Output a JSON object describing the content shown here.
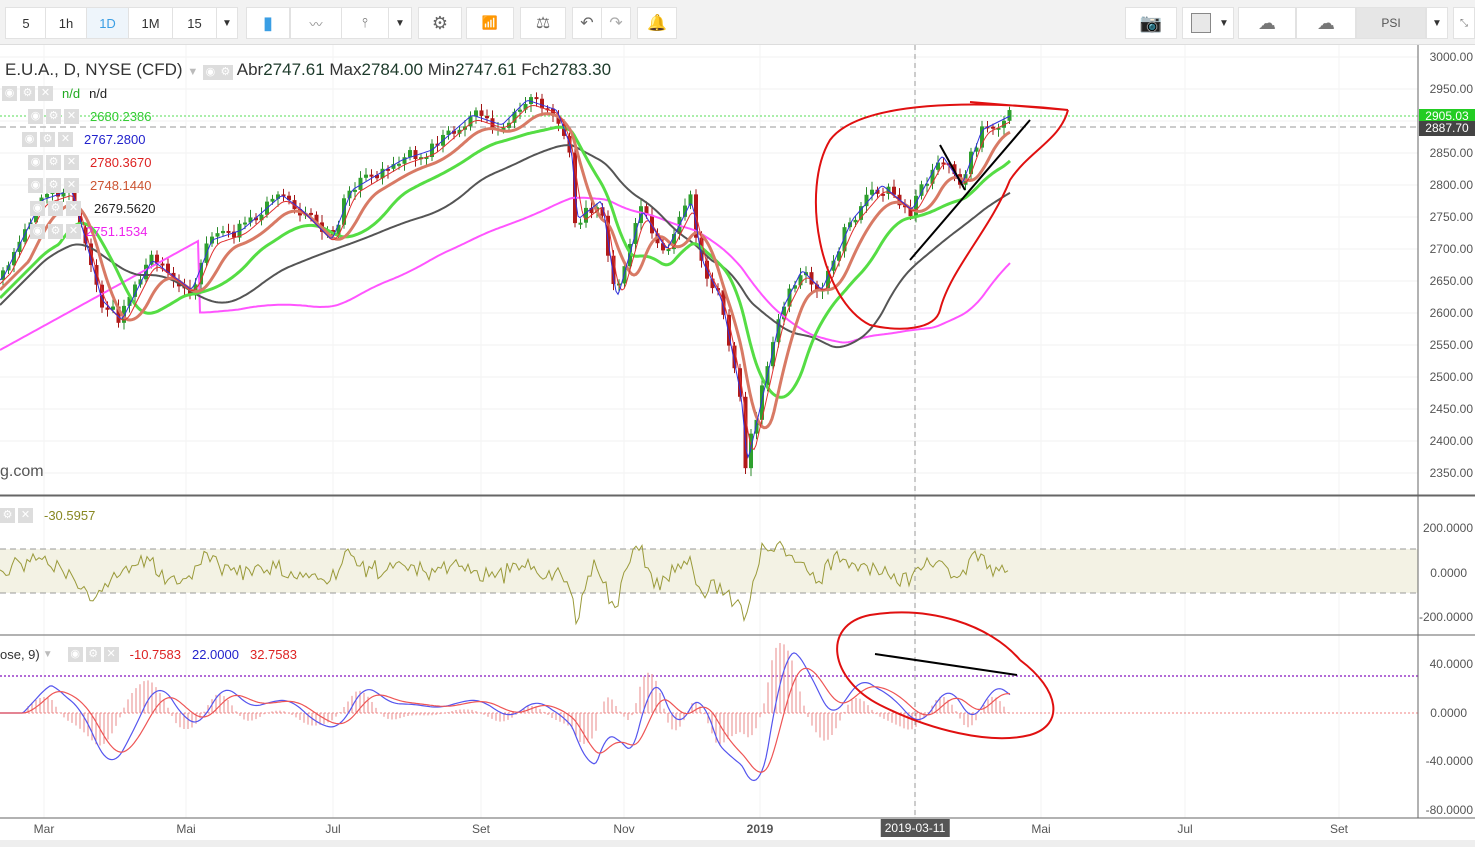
{
  "toolbar": {
    "intervals": [
      "5",
      "1h",
      "1D",
      "1M",
      "15"
    ],
    "active_interval": "1D",
    "icons": [
      "candles-icon",
      "line-chart-icon",
      "indicators-icon",
      "settings-icon",
      "studies-icon",
      "compare-icon",
      "undo-icon",
      "redo-icon",
      "alert-icon",
      "camera-icon",
      "color-square-icon",
      "cloud-download-icon",
      "cloud-upload-icon"
    ],
    "symbol_button": "PSI"
  },
  "legend": {
    "symbol": "E.U.A., D, NYSE (CFD)",
    "open_label": "Abr",
    "open": "2747.61",
    "high_label": "Max",
    "high": "2784.00",
    "low_label": "Min",
    "low": "2747.61",
    "close_label": "Fch",
    "close": "2783.30"
  },
  "indicators": [
    {
      "values": [
        "n/d",
        "n/d"
      ],
      "colors": [
        "#22aa22",
        "#222222"
      ]
    },
    {
      "value": "2680.2386",
      "color": "#33cc33"
    },
    {
      "value": "2767.2800",
      "color": "#2222cc"
    },
    {
      "value": "2780.3670",
      "color": "#dd2222"
    },
    {
      "value": "2748.1440",
      "color": "#cc5533"
    },
    {
      "value": "2679.5620",
      "color": "#222222"
    },
    {
      "value": "2751.1534",
      "color": "#ee22ee"
    }
  ],
  "watermark": "g.com",
  "price_axis": [
    "3000.00",
    "2950.00",
    "2850.00",
    "2800.00",
    "2750.00",
    "2700.00",
    "2650.00",
    "2600.00",
    "2550.00",
    "2500.00",
    "2450.00",
    "2400.00",
    "2350.00"
  ],
  "price_badges": {
    "green": "2905.03",
    "dark": "2887.70"
  },
  "cci": {
    "value": "-30.5957",
    "axis": [
      "200.0000",
      "0.0000",
      "-200.0000"
    ]
  },
  "macd": {
    "label": "ose, 9)",
    "values": [
      "-10.7583",
      "22.0000",
      "32.7583"
    ],
    "colors": [
      "#dd2222",
      "#2222cc",
      "#dd2222"
    ],
    "axis": [
      "40.0000",
      "0.0000",
      "-40.0000",
      "-80.0000"
    ]
  },
  "time_axis": [
    "Mar",
    "Mai",
    "Jul",
    "Set",
    "Nov",
    "2019",
    "Mai",
    "Jul",
    "Set"
  ],
  "crosshair_date": "2019-03-11"
}
